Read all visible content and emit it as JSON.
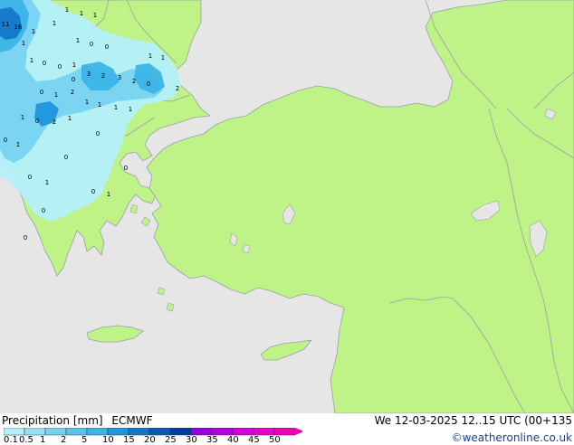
{
  "footer": {
    "title": "Precipitation [mm]",
    "model": "ECMWF",
    "run": "We 12-03-2025 12..15 UTC (00+135",
    "credit": "©weatheronline.co.uk"
  },
  "legend": {
    "ticks": [
      "0.1",
      "0.5",
      "1",
      "2",
      "5",
      "10",
      "15",
      "20",
      "25",
      "30",
      "35",
      "40",
      "45",
      "50"
    ],
    "colors": [
      "#b4f0fa",
      "#96e1f5",
      "#78d2f0",
      "#5ac3eb",
      "#3cb4e6",
      "#1e96dc",
      "#1478c8",
      "#0a5ab4",
      "#003ca0",
      "#9600dc",
      "#b400dc",
      "#d200dc",
      "#e600c8",
      "#f000b4"
    ]
  },
  "map": {
    "land_color": "#bff287",
    "sea_color": "#e6e6e6",
    "border_color": "#9aa0a6",
    "precip_labels": [
      "11",
      "16",
      "1",
      "1",
      "1",
      "1",
      "1",
      "1",
      "1",
      "0",
      "0",
      "1",
      "1",
      "0",
      "0",
      "1",
      "1",
      "0",
      "3",
      "2",
      "3",
      "2",
      "0",
      "2",
      "0",
      "1",
      "2",
      "1",
      "1",
      "1",
      "1",
      "0",
      "2",
      "1",
      "1",
      "0",
      "1",
      "0",
      "0",
      "0",
      "0",
      "1",
      "0",
      "1",
      "0",
      "0"
    ]
  }
}
